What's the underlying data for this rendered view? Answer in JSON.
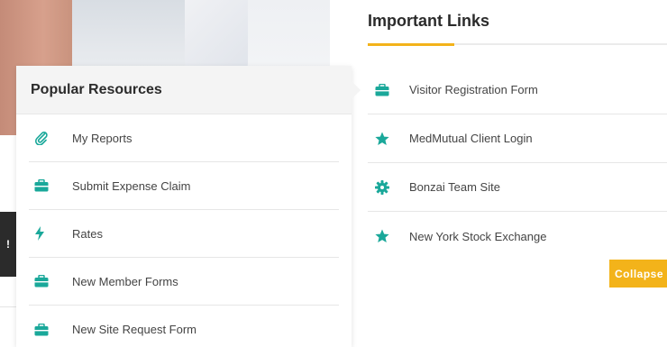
{
  "colors": {
    "accent_teal": "#1aa89a",
    "accent_yellow": "#f3b31a"
  },
  "resources": {
    "title": "Popular Resources",
    "items": [
      {
        "label": "My Reports",
        "icon": "paperclip-icon"
      },
      {
        "label": "Submit Expense Claim",
        "icon": "briefcase-icon"
      },
      {
        "label": "Rates",
        "icon": "lightning-icon"
      },
      {
        "label": "New Member Forms",
        "icon": "briefcase-icon"
      },
      {
        "label": "New Site Request Form",
        "icon": "briefcase-icon"
      }
    ]
  },
  "links": {
    "title": "Important Links",
    "items": [
      {
        "label": "Visitor Registration Form",
        "icon": "briefcase-icon"
      },
      {
        "label": "MedMutual Client Login",
        "icon": "star-icon"
      },
      {
        "label": "Bonzai Team Site",
        "icon": "gear-icon"
      },
      {
        "label": "New York Stock Exchange",
        "icon": "star-icon"
      }
    ],
    "collapse_label": "Collapse"
  },
  "side_tab": {
    "label": "!"
  }
}
